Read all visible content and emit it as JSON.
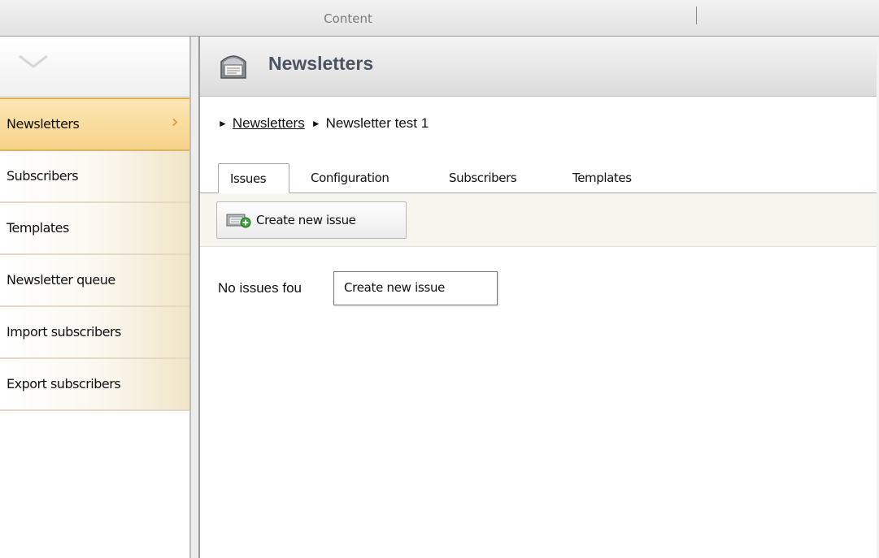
{
  "window": {
    "title": "Content"
  },
  "sidebar": {
    "items": [
      {
        "label": "Newsletters",
        "active": true
      },
      {
        "label": "Subscribers",
        "active": false
      },
      {
        "label": "Templates",
        "active": false
      },
      {
        "label": "Newsletter queue",
        "active": false
      },
      {
        "label": "Import subscribers",
        "active": false
      },
      {
        "label": "Export subscribers",
        "active": false
      }
    ],
    "collapse_icon": "chevron-down-icon",
    "active_icon": "chevron-right-icon"
  },
  "header": {
    "title": "Newsletters",
    "icon": "newsletter-icon"
  },
  "breadcrumb": {
    "link": "Newsletters",
    "current": "Newsletter test 1"
  },
  "tabs": [
    {
      "label": "Issues",
      "active": true
    },
    {
      "label": "Configuration",
      "active": false
    },
    {
      "label": "Subscribers",
      "active": false
    },
    {
      "label": "Templates",
      "active": false
    }
  ],
  "toolbar": {
    "create_label": "Create new issue",
    "create_icon": "add-issue-icon"
  },
  "content": {
    "empty_message": "No issues fou"
  },
  "tooltip": {
    "text": "Create new issue"
  },
  "colors": {
    "active_item": "#f7d38a",
    "accent_chevron": "#e58d2a",
    "header_title": "#4a5563"
  }
}
